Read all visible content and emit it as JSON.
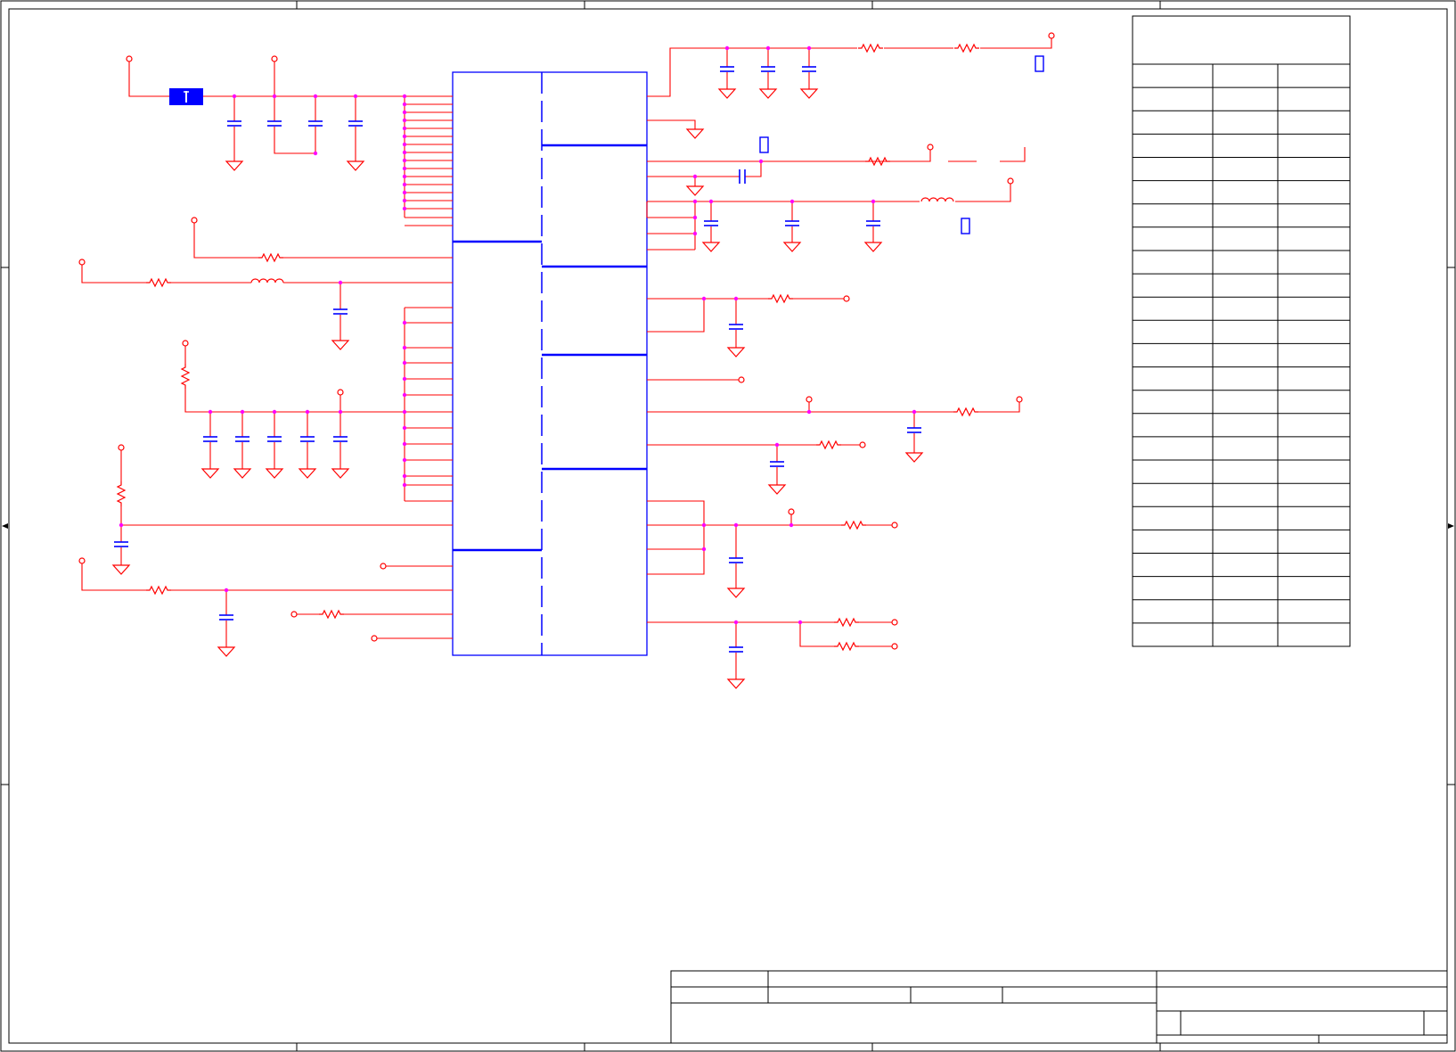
{
  "colors": {
    "background": "#ffffff",
    "border": "#000000",
    "wire": "#ff0000",
    "junction": "#ff00ff",
    "component": "#0000ff"
  },
  "components": {
    "capacitors": 26,
    "resistors": 19,
    "inductors": 3,
    "ground_symbols": 24
  },
  "table": {
    "rows": 24,
    "columns": 3
  }
}
